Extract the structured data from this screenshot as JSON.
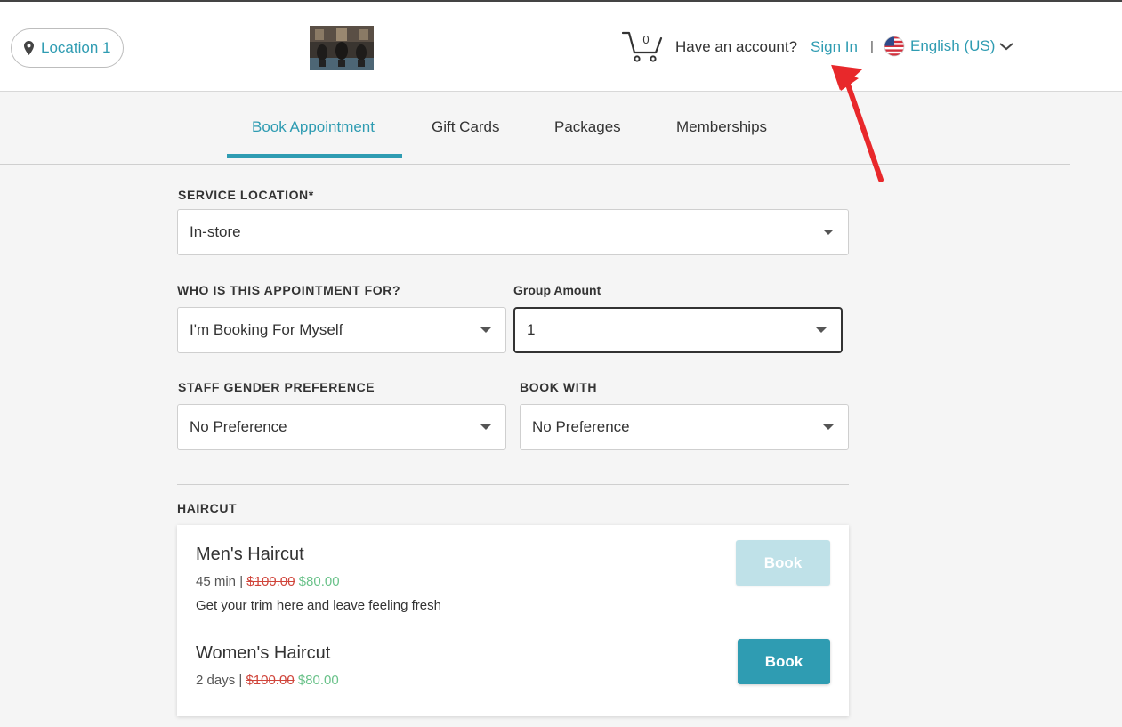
{
  "header": {
    "location_label": "Location 1",
    "cart_count": "0",
    "account_prompt": "Have an account?",
    "signin_label": "Sign In",
    "separator": "|",
    "language_label": "English (US)"
  },
  "tabs": [
    {
      "label": "Book Appointment",
      "active": true
    },
    {
      "label": "Gift Cards",
      "active": false
    },
    {
      "label": "Packages",
      "active": false
    },
    {
      "label": "Memberships",
      "active": false
    }
  ],
  "form": {
    "service_location": {
      "label": "SERVICE LOCATION*",
      "value": "In-store"
    },
    "appointment_for": {
      "label": "WHO IS THIS APPOINTMENT FOR?",
      "value": "I'm Booking For Myself"
    },
    "group_amount": {
      "label": "Group Amount",
      "value": "1"
    },
    "staff_gender": {
      "label": "STAFF GENDER PREFERENCE",
      "value": "No Preference"
    },
    "book_with": {
      "label": "BOOK WITH",
      "value": "No Preference"
    }
  },
  "category": {
    "title": "HAIRCUT",
    "services": [
      {
        "name": "Men's Haircut",
        "duration": "45 min |",
        "old_price": "$100.00",
        "new_price": "$80.00",
        "description": "Get your trim here and leave feeling fresh",
        "book_label": "Book",
        "enabled": false
      },
      {
        "name": "Women's Haircut",
        "duration": "2 days |",
        "old_price": "$100.00",
        "new_price": "$80.00",
        "description": "",
        "book_label": "Book",
        "enabled": true
      }
    ]
  },
  "colors": {
    "accent": "#2f9cb2",
    "old_price": "#d0453b",
    "new_price": "#6ac28a",
    "annotation_arrow": "#e8282b"
  },
  "icons": [
    "map-pin-icon",
    "cart-icon",
    "us-flag-icon",
    "chevron-down-icon",
    "dropdown-caret-icon"
  ]
}
